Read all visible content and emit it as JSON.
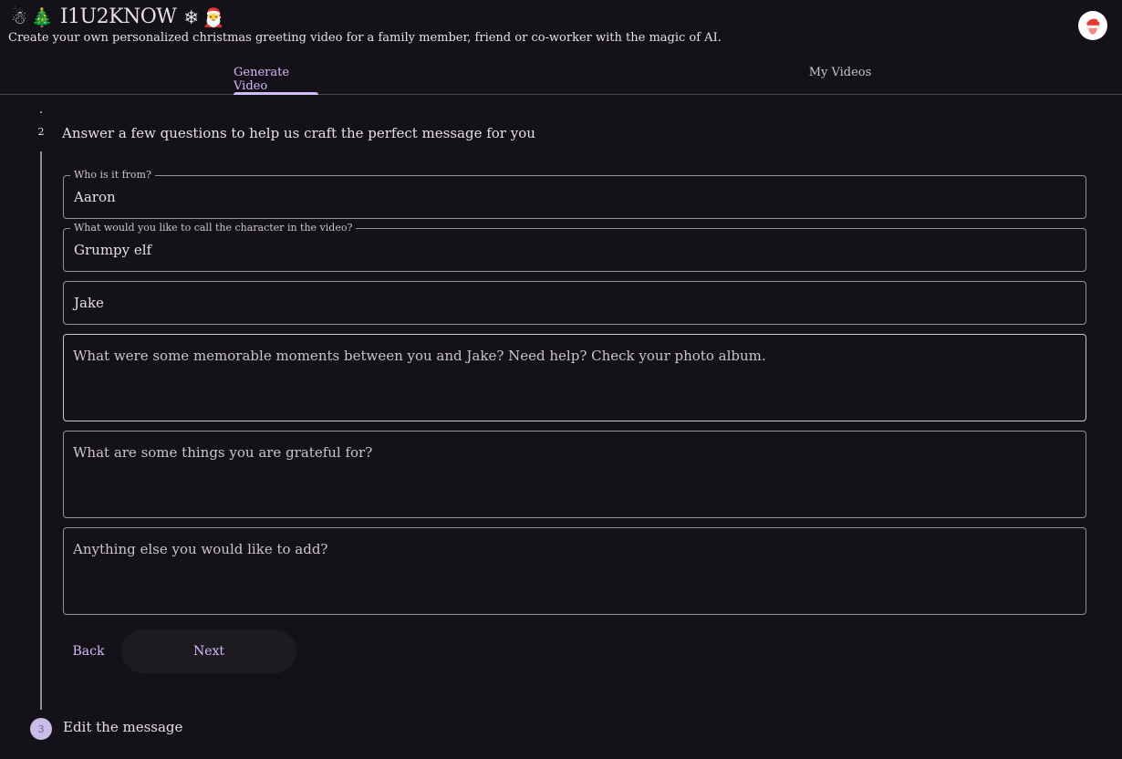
{
  "header": {
    "brand_name": "I1U2KNOW",
    "emojis": {
      "snowman": "☃",
      "tree": "🎄",
      "snowflake": "❄",
      "santa": "🎅"
    },
    "tagline": "Create your own personalized christmas greeting video for a family member, friend or co-worker with the magic of AI.",
    "avatar_icon": "santa-hat-avatar"
  },
  "tabs": [
    {
      "label": "Generate Video",
      "active": true
    },
    {
      "label": "My Videos",
      "active": false
    }
  ],
  "step2": {
    "number": "2",
    "title": "Answer a few questions to help us craft the perfect message for you"
  },
  "form": {
    "from": {
      "label": "Who is it from?",
      "value": "Aaron"
    },
    "character": {
      "label": "What would you like to call the character in the video?",
      "value": "Grumpy elf"
    },
    "recipient": {
      "value": "Jake"
    },
    "memories": {
      "placeholder": "What were some memorable moments between you and Jake?  Need help?  Check your photo album."
    },
    "grateful": {
      "placeholder": "What are some things you are grateful for?"
    },
    "extra": {
      "placeholder": "Anything else you would like to add?"
    }
  },
  "buttons": {
    "back": "Back",
    "next": "Next"
  },
  "step3": {
    "number": "3",
    "title": "Edit the message"
  },
  "colors": {
    "background": "#141218",
    "accent": "#d0bcff",
    "outline": "#938f99"
  }
}
